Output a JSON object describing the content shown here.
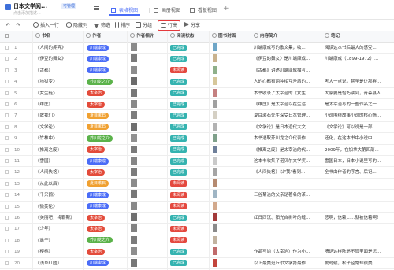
{
  "app": {
    "title": "日本文学阅...",
    "badge": "可管理",
    "subtitle": "点击添加描述..."
  },
  "tabs": [
    {
      "label": "视图"
    },
    {
      "label": "画册视图"
    },
    {
      "label": "看板视图"
    }
  ],
  "toolbar": {
    "insert": "插入一行",
    "hide": "隐藏列",
    "filter": "筛选",
    "sort": "排序",
    "group": "分组",
    "rowheight": "行高",
    "share": "分享"
  },
  "columns": [
    "书名",
    "作者",
    "作者相片",
    "阅读状态",
    "图书封面",
    "内容简介",
    "笔记"
  ],
  "colors": {
    "accent": "#4a6cf7",
    "done": "#35b3b0",
    "not": "#e4493f",
    "highlight": "#e4393c"
  },
  "rows": [
    {
      "n": "1",
      "title": "《人间的疼弃》",
      "author": "川端康成",
      "ac": "#4a6cf7",
      "status": "已完成",
      "s": "done",
      "photo": "#8a8a8a",
      "cover": "#6fa6c7",
      "desc": "川端康成写的散文集，收...",
      "note": "阅读这本书后最大的感受..."
    },
    {
      "n": "2",
      "title": "《伊豆的舞女》",
      "author": "川端康成",
      "ac": "#4a6cf7",
      "status": "已完成",
      "s": "done",
      "photo": "#7a7a7a",
      "cover": "#c9b28d",
      "desc": "《伊豆的舞女》是川端康成...",
      "note": "川端康成（1899-1972）..."
    },
    {
      "n": "3",
      "title": "《古都》",
      "author": "川端康成",
      "ac": "#4a6cf7",
      "status": "未阅读",
      "s": "not",
      "photo": "#8d8d8d",
      "cover": "#8fb08a",
      "desc": "《古都》讲述川端康成描写...",
      "note": ""
    },
    {
      "n": "4",
      "title": "《地狱变》",
      "author": "芥川龙之介",
      "ac": "#5bb24a",
      "status": "已完成",
      "s": "done",
      "photo": "#6b6b6b",
      "cover": "#d6c79a",
      "desc": "人的心都有两种相互矛盾的...",
      "note": "考大一点说，甚至是让那样..."
    },
    {
      "n": "5",
      "title": "《女生徒》",
      "author": "太宰治",
      "ac": "#e34b3a",
      "status": "已完成",
      "s": "done",
      "photo": "#777",
      "cover": "#c48080",
      "desc": "本书收录了太宰治的《女生...",
      "note": "大家要是恰巧读到，青森县人..."
    },
    {
      "n": "6",
      "title": "《维庄》",
      "author": "太宰治",
      "ac": "#e34b3a",
      "status": "已完成",
      "s": "done",
      "photo": "#888",
      "cover": "#a0a0a0",
      "desc": "《维庄》是太宰治以在生活...",
      "note": "是太宰治写的一些作品之一..."
    },
    {
      "n": "7",
      "title": "《致我们》",
      "author": "夏目漱石",
      "ac": "#f0a030",
      "status": "已完成",
      "s": "done",
      "photo": "#7d7d7d",
      "cover": "#d5d0c4",
      "desc": "夏目漱石先生深受日本管理...",
      "note": "小说围绕故事小说的核心情..."
    },
    {
      "n": "8",
      "title": "《文学论》",
      "author": "夏目漱石",
      "ac": "#f0a030",
      "status": "已完成",
      "s": "done",
      "photo": "#6e6e6e",
      "cover": "#b2b2b2",
      "desc": "《文学论》是日本近代大文...",
      "note": "《文学论》可以说是一部..."
    },
    {
      "n": "9",
      "title": "《竹林中》",
      "author": "芥川龙之介",
      "ac": "#5bb24a",
      "status": "已完成",
      "s": "done",
      "photo": "#909090",
      "cover": "#7fa08a",
      "desc": "本书选取芥川龙之介代表作...",
      "note": "还化，在这本书中小说中...."
    },
    {
      "n": "10",
      "title": "《推离之废》",
      "author": "太宰治",
      "ac": "#e34b3a",
      "status": "已完成",
      "s": "done",
      "photo": "#7a7a7a",
      "cover": "#6e7f9a",
      "desc": "《推离之废》是太宰治的代...",
      "note": "2009年，在加拿大第四部..."
    },
    {
      "n": "11",
      "title": "《雪国》",
      "author": "川端康成",
      "ac": "#4a6cf7",
      "status": "已完成",
      "s": "done",
      "photo": "#858585",
      "cover": "#c9c9c9",
      "desc": "这本书收集了诺贝尔文学奖...",
      "note": "雪国日本，日本小说里写的..."
    },
    {
      "n": "12",
      "title": "《人间失格》",
      "author": "太宰治",
      "ac": "#e34b3a",
      "status": "已完成",
      "s": "done",
      "photo": "#7c7c7c",
      "cover": "#a5a5a5",
      "desc": "《人间失格》以\"我\"看到...",
      "note": "全书由作者的序言、后记..."
    },
    {
      "n": "13",
      "title": "《从此以后》",
      "author": "夏目漱石",
      "ac": "#f0a030",
      "status": "未阅读",
      "s": "not",
      "photo": "#8b8b8b",
      "cover": "#b58a70",
      "desc": "",
      "note": ""
    },
    {
      "n": "14",
      "title": "《千只鹤》",
      "author": "川端康成",
      "ac": "#4a6cf7",
      "status": "未阅读",
      "s": "not",
      "photo": "#777",
      "cover": "#9fb5c4",
      "desc": "三谷菊治的父亲是著名的茶...",
      "note": ""
    },
    {
      "n": "15",
      "title": "《微笑论》",
      "author": "川端康成",
      "ac": "#4a6cf7",
      "status": "未阅读",
      "s": "not",
      "photo": "#888",
      "cover": "#d2a98c",
      "desc": "",
      "note": ""
    },
    {
      "n": "16",
      "title": "《美丽吧，梅勒斯》",
      "author": "太宰治",
      "ac": "#e34b3a",
      "status": "已完成",
      "s": "done",
      "photo": "#6f6f6f",
      "cover": "#a23a3a",
      "desc": "红日西沉、阳光自树叶的缝...",
      "note": "悲啊，信赖……就被信着啊！"
    },
    {
      "n": "17",
      "title": "《少年》",
      "author": "太宰治",
      "ac": "#e34b3a",
      "status": "未阅读",
      "s": "not",
      "photo": "#828282",
      "cover": "#8a8a8a",
      "desc": "",
      "note": ""
    },
    {
      "n": "18",
      "title": "《鼻子》",
      "author": "芥川龙之介",
      "ac": "#5bb24a",
      "status": "未阅读",
      "s": "not",
      "photo": "#7b7b7b",
      "cover": "#c2b3a0",
      "desc": "",
      "note": ""
    },
    {
      "n": "19",
      "title": "《樱桃》",
      "author": "太宰治",
      "ac": "#e34b3a",
      "status": "已完成",
      "s": "done",
      "photo": "#8d8d8d",
      "cover": "#c06b6b",
      "desc": "作品写尚（太宰治）作为小...",
      "note": "嘈话这样陈述不管里面是怎..."
    },
    {
      "n": "20",
      "title": "《浅草红团》",
      "author": "川端康成",
      "ac": "#4a6cf7",
      "status": "已完成",
      "s": "done",
      "photo": "#767676",
      "cover": "#c2443c",
      "desc": "以上最美逛丘尔文学第最作...",
      "note": "爱时候，松子径常却很美..."
    }
  ]
}
